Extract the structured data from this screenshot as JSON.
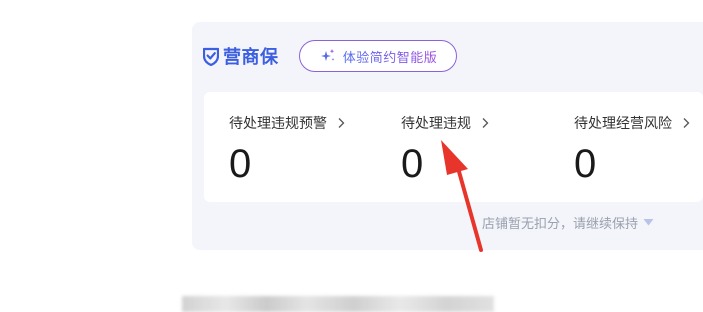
{
  "header": {
    "brand_name": "营商保",
    "trial_button_label": "体验简约智能版"
  },
  "metrics": [
    {
      "title": "待处理违规预警",
      "value": "0"
    },
    {
      "title": "待处理违规",
      "value": "0"
    },
    {
      "title": "待处理经营风险",
      "value": "0"
    }
  ],
  "status": {
    "message": "店铺暂无扣分，请继续保持"
  },
  "icons": {
    "brand": "shield-check-icon",
    "trial": "sparkle-icon",
    "metric_link": "chevron-right-icon",
    "status_expand": "triangle-down-icon",
    "annotation": "red-arrow-icon"
  },
  "colors": {
    "brand": "#3b5fe0",
    "trial_border": "#8c63d6",
    "annotation": "#e8352b",
    "panel_bg": "#f3f5fb",
    "muted_text": "#9aa0ad"
  }
}
